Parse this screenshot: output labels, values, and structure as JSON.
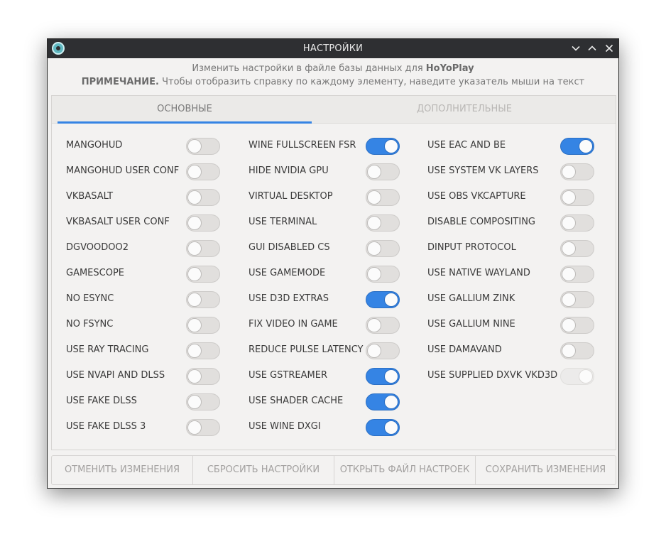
{
  "window": {
    "title": "НАСТРОЙКИ"
  },
  "header": {
    "line1_prefix": "Изменить настройки в файле базы данных для",
    "app_name": "HoYoPlay",
    "note_label": "ПРИМЕЧАНИЕ.",
    "note_text": "Чтобы отобразить справку по каждому элементу, наведите указатель мыши на текст"
  },
  "tabs": [
    {
      "label": "ОСНОВНЫЕ",
      "active": true
    },
    {
      "label": "ДОПОЛНИТЕЛЬНЫЕ",
      "active": false
    }
  ],
  "columns": [
    [
      {
        "label": "MANGOHUD",
        "state": "off"
      },
      {
        "label": "MANGOHUD USER CONF",
        "state": "off"
      },
      {
        "label": "VKBASALT",
        "state": "off"
      },
      {
        "label": "VKBASALT USER CONF",
        "state": "off"
      },
      {
        "label": "DGVOODOO2",
        "state": "off"
      },
      {
        "label": "GAMESCOPE",
        "state": "off"
      },
      {
        "label": "NO ESYNC",
        "state": "off"
      },
      {
        "label": "NO FSYNC",
        "state": "off"
      },
      {
        "label": "USE RAY TRACING",
        "state": "off"
      },
      {
        "label": "USE NVAPI AND DLSS",
        "state": "off"
      },
      {
        "label": "USE FAKE DLSS",
        "state": "off"
      },
      {
        "label": "USE FAKE DLSS 3",
        "state": "off"
      }
    ],
    [
      {
        "label": "WINE FULLSCREEN FSR",
        "state": "on"
      },
      {
        "label": "HIDE NVIDIA GPU",
        "state": "off"
      },
      {
        "label": "VIRTUAL DESKTOP",
        "state": "off"
      },
      {
        "label": "USE TERMINAL",
        "state": "off"
      },
      {
        "label": "GUI DISABLED CS",
        "state": "off"
      },
      {
        "label": "USE GAMEMODE",
        "state": "off"
      },
      {
        "label": "USE D3D EXTRAS",
        "state": "on"
      },
      {
        "label": "FIX VIDEO IN GAME",
        "state": "off"
      },
      {
        "label": "REDUCE PULSE LATENCY",
        "state": "off"
      },
      {
        "label": "USE GSTREAMER",
        "state": "on"
      },
      {
        "label": "USE SHADER CACHE",
        "state": "on"
      },
      {
        "label": "USE WINE DXGI",
        "state": "on"
      }
    ],
    [
      {
        "label": "USE EAC AND BE",
        "state": "on"
      },
      {
        "label": "USE SYSTEM VK LAYERS",
        "state": "off"
      },
      {
        "label": "USE OBS VKCAPTURE",
        "state": "off"
      },
      {
        "label": "DISABLE COMPOSITING",
        "state": "off"
      },
      {
        "label": "DINPUT PROTOCOL",
        "state": "off"
      },
      {
        "label": "USE NATIVE WAYLAND",
        "state": "off"
      },
      {
        "label": "USE GALLIUM ZINK",
        "state": "off"
      },
      {
        "label": "USE GALLIUM NINE",
        "state": "off"
      },
      {
        "label": "USE DAMAVAND",
        "state": "off"
      },
      {
        "label": "USE SUPPLIED DXVK VKD3D",
        "state": "disabled-on"
      }
    ]
  ],
  "buttons": [
    {
      "label": "ОТМЕНИТЬ ИЗМЕНЕНИЯ"
    },
    {
      "label": "СБРОСИТЬ НАСТРОЙКИ"
    },
    {
      "label": "ОТКРЫТЬ ФАЙЛ НАСТРОЕК"
    },
    {
      "label": "СОХРАНИТЬ ИЗМЕНЕНИЯ"
    }
  ],
  "colors": {
    "accent": "#3584e4",
    "titlebar": "#2e2f32",
    "background": "#f3f2f1"
  }
}
